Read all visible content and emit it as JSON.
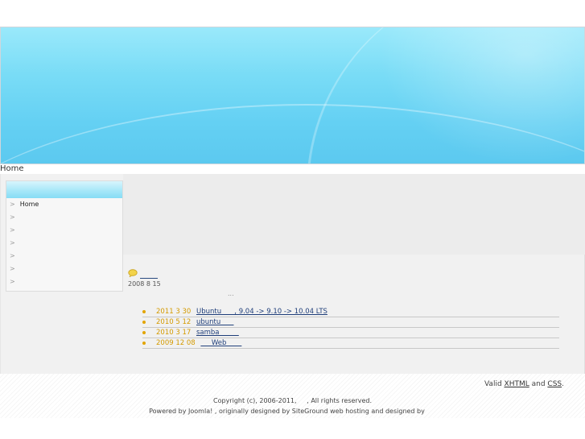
{
  "breadcrumb": {
    "home_label": "Home"
  },
  "sidebar": {
    "arrow": ">",
    "items": [
      {
        "label": "Home"
      },
      {
        "label": ""
      },
      {
        "label": ""
      },
      {
        "label": ""
      },
      {
        "label": ""
      },
      {
        "label": ""
      },
      {
        "label": ""
      }
    ]
  },
  "article": {
    "date": "2008  8  15",
    "ellipsis": "..."
  },
  "latest": [
    {
      "date": "2011  3  30",
      "link": "Ubuntu      , 9.04 -> 9.10 -> 10.04 LTS"
    },
    {
      "date": "2010  5  12",
      "link": "ubuntu      "
    },
    {
      "date": "2010  3  17",
      "link": "samba         "
    },
    {
      "date": "2009  12  08",
      "link": "     Web       "
    }
  ],
  "footer": {
    "valid_prefix": "Valid ",
    "xhtml": "XHTML",
    "and": " and ",
    "css": "CSS",
    "period": ".",
    "copyright": "Copyright (c), 2006-2011,     , All rights reserved.",
    "powered": "Powered by Joomla! , originally designed by SiteGround web hosting and designed by"
  },
  "colors": {
    "header_blue": "#64d0f3",
    "link_blue": "#1f3e7a",
    "date_gold": "#d49a00"
  }
}
